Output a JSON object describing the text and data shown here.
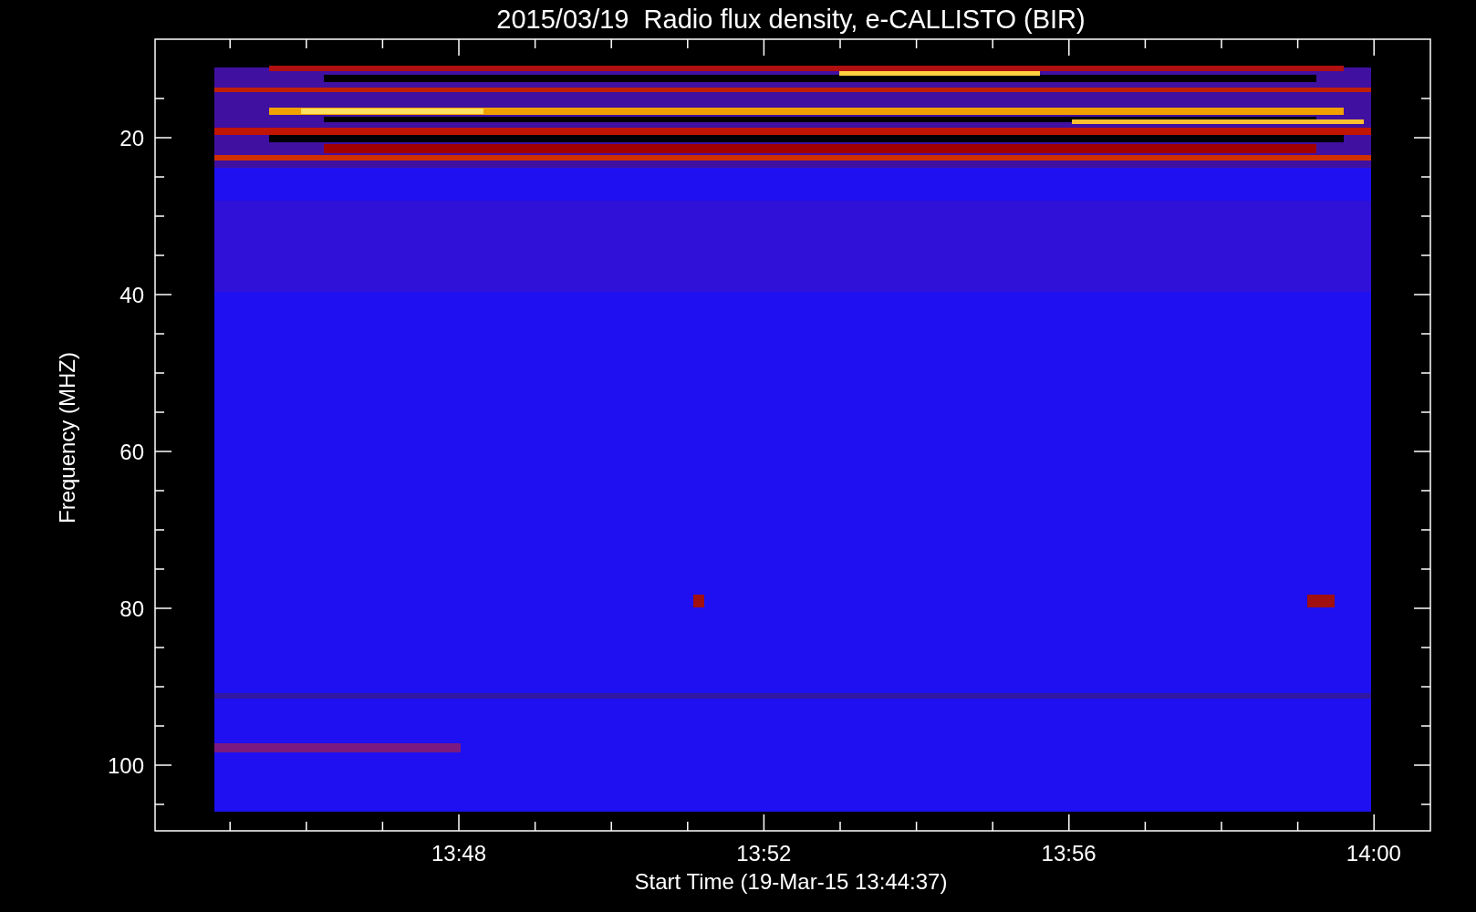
{
  "title": "2015/03/19  Radio flux density, e-CALLISTO (BIR)",
  "xlabel": "Start Time (19-Mar-15 13:44:37)",
  "ylabel": "Frequency (MHZ)",
  "xticks": [
    "13:48",
    "13:52",
    "13:56",
    "14:00"
  ],
  "yticks": [
    "20",
    "40",
    "60",
    "80",
    "100"
  ]
}
